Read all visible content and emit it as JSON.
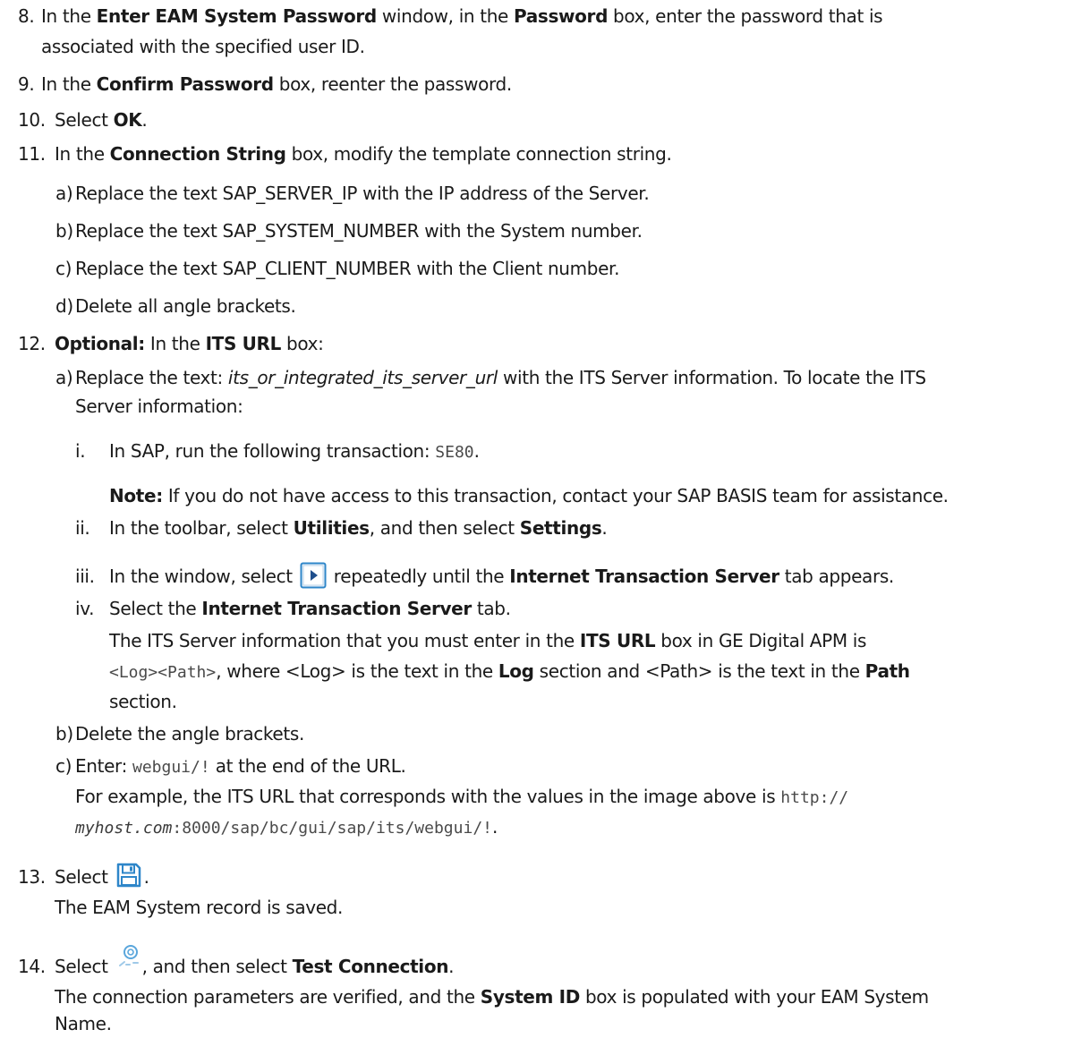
{
  "steps": {
    "s8": {
      "num": "8.",
      "p1": "In the ",
      "b1": "Enter EAM System Password",
      "p2": " window, in the ",
      "b2": "Password",
      "p3": " box, enter the password that is",
      "line2": "associated with the specified user ID."
    },
    "s9": {
      "num": "9.",
      "p1": "In the ",
      "b1": "Confirm Password",
      "p2": " box, reenter the password."
    },
    "s10": {
      "num": "10.",
      "p1": "Select ",
      "b1": "OK",
      "p2": "."
    },
    "s11": {
      "num": "11.",
      "p1": "In the ",
      "b1": "Connection String",
      "p2": " box, modify the template connection string.",
      "subs": [
        {
          "label": "a)",
          "text": "Replace the text SAP_SERVER_IP with the IP address of the Server."
        },
        {
          "label": "b)",
          "text": "Replace the text SAP_SYSTEM_NUMBER with the System number."
        },
        {
          "label": "c)",
          "text": "Replace the text SAP_CLIENT_NUMBER with the Client number."
        },
        {
          "label": "d)",
          "text": "Delete all angle brackets."
        }
      ]
    },
    "s12": {
      "num": "12.",
      "b1": "Optional:",
      "p1": " In the ",
      "b2": "ITS URL",
      "p2": " box:",
      "a": {
        "label": "a)",
        "p1": "Replace the text: ",
        "i1": "its_or_integrated_its_server_url",
        "p2": " with the ITS Server information. To locate the ITS",
        "line2": "Server information:",
        "roman": {
          "i": {
            "label": "i.",
            "p1": "In SAP, run the following transaction: ",
            "code": "SE80",
            "p2": ".",
            "note_b": "Note:",
            "note": " If you do not have access to this transaction, contact your SAP BASIS team for assistance."
          },
          "ii": {
            "label": "ii.",
            "p1": "In the toolbar, select ",
            "b1": "Utilities",
            "p2": ", and then select ",
            "b2": "Settings",
            "p3": "."
          },
          "iii": {
            "label": "iii.",
            "p1": "In the window, select ",
            "p2": " repeatedly until the ",
            "b1": "Internet Transaction Server",
            "p3": " tab appears."
          },
          "iv": {
            "label": "iv.",
            "p1": "Select the ",
            "b1": "Internet Transaction Server",
            "p2": " tab.",
            "r1p1": "The ITS Server information that you must enter in the ",
            "r1b1": "ITS URL",
            "r1p2": " box in GE Digital APM is",
            "r2code": "<Log><Path>",
            "r2p1": ", where <Log> is the text in the ",
            "r2b1": "Log",
            "r2p2": " section and <Path> is the text in the ",
            "r2b2": "Path",
            "r3": "section."
          }
        }
      },
      "b": {
        "label": "b)",
        "text": "Delete the angle brackets."
      },
      "c": {
        "label": "c)",
        "p1": "Enter: ",
        "code": "webgui/!",
        "p2": " at the end of the URL.",
        "r1": "For example, the ITS URL that corresponds with the values in the image above is ",
        "r1code": "http://",
        "r2code_i": "myhost.com",
        "r2code": ":8000/sap/bc/gui/sap/its/webgui/!",
        "r2p": "."
      }
    },
    "s13": {
      "num": "13.",
      "p1": "Select ",
      "p2": ".",
      "result": "The EAM System record is saved."
    },
    "s14": {
      "num": "14.",
      "p1": "Select ",
      "p2": ", and then select ",
      "b1": "Test Connection",
      "p3": ".",
      "r1p1": "The connection parameters are verified, and the ",
      "r1b1": "System ID",
      "r1p2": " box is populated with your EAM System",
      "r2": "Name."
    }
  },
  "icons": {
    "next": "next-page-icon",
    "save": "save-icon",
    "connection": "connection-icon"
  },
  "colors": {
    "icon_blue": "#2e86c9",
    "text": "#1a1a1a"
  }
}
